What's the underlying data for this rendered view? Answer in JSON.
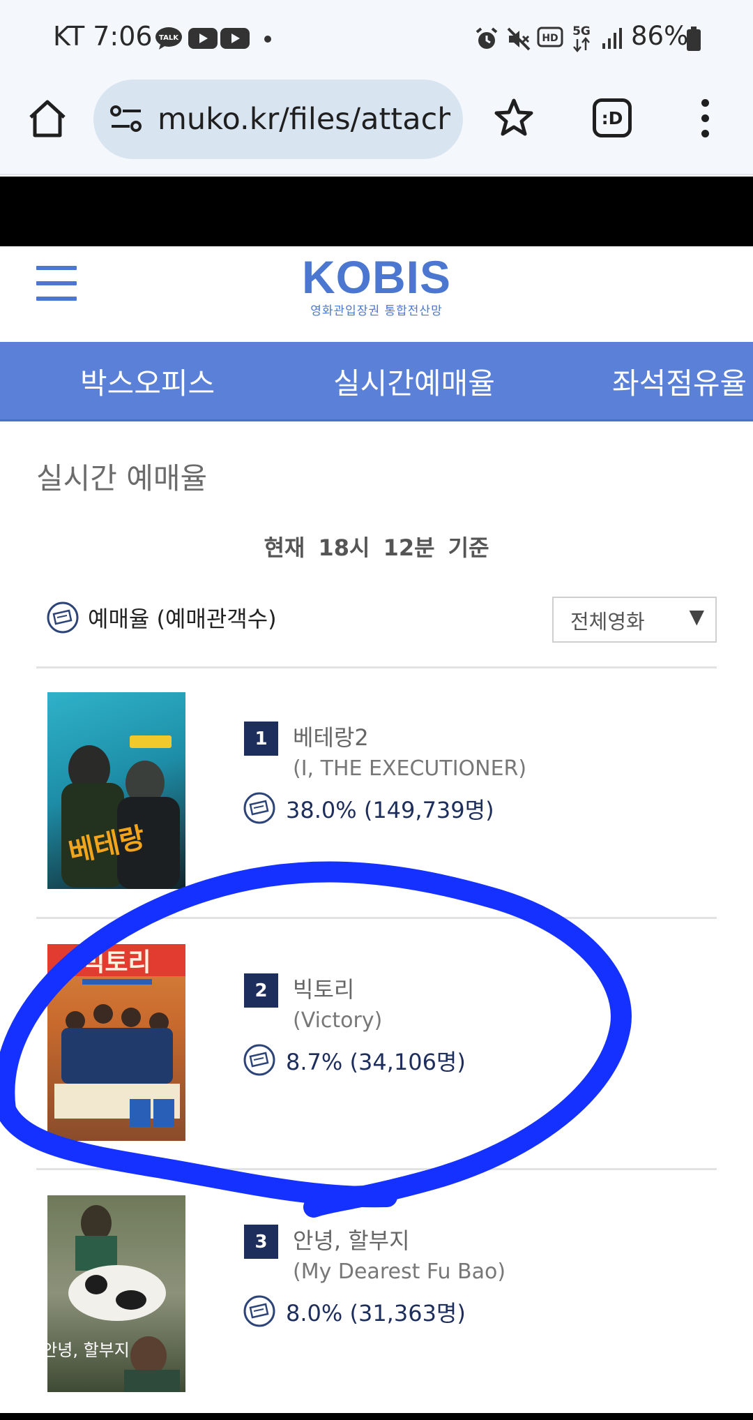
{
  "status_bar": {
    "carrier_time": "KT 7:06",
    "battery": "86%"
  },
  "browser": {
    "url": "muko.kr/files/attach/i",
    "tabs_label": ":D"
  },
  "site": {
    "logo": "KOBIS",
    "logo_sub": "영화관입장권 통합전산망"
  },
  "nav": {
    "items": [
      {
        "label": "박스오피스"
      },
      {
        "label": "실시간예매율"
      },
      {
        "label": "좌석점유율"
      }
    ]
  },
  "page": {
    "title": "실시간 예매율",
    "reference_time": "현재 18시 12분 기준",
    "rate_label": "예매율 (예매관객수)",
    "filter_value": "전체영화",
    "filter_arrow": "▼"
  },
  "movies": [
    {
      "rank": "1",
      "title": "베테랑2",
      "english_title": "(I, THE EXECUTIONER)",
      "rate": "38.0% (149,739명)",
      "poster_text": "베테랑"
    },
    {
      "rank": "2",
      "title": "빅토리",
      "english_title": "(Victory)",
      "rate": "8.7% (34,106명)",
      "poster_text": "빅토리"
    },
    {
      "rank": "3",
      "title": "안녕, 할부지",
      "english_title": "(My Dearest Fu Bao)",
      "rate": "8.0% (31,363명)",
      "poster_text": "안녕, 할부지"
    }
  ],
  "colors": {
    "brand": "#4c77d0",
    "nav_band": "#5a80d8",
    "rank_badge": "#1e2e5c",
    "scribble": "#1431ff"
  }
}
